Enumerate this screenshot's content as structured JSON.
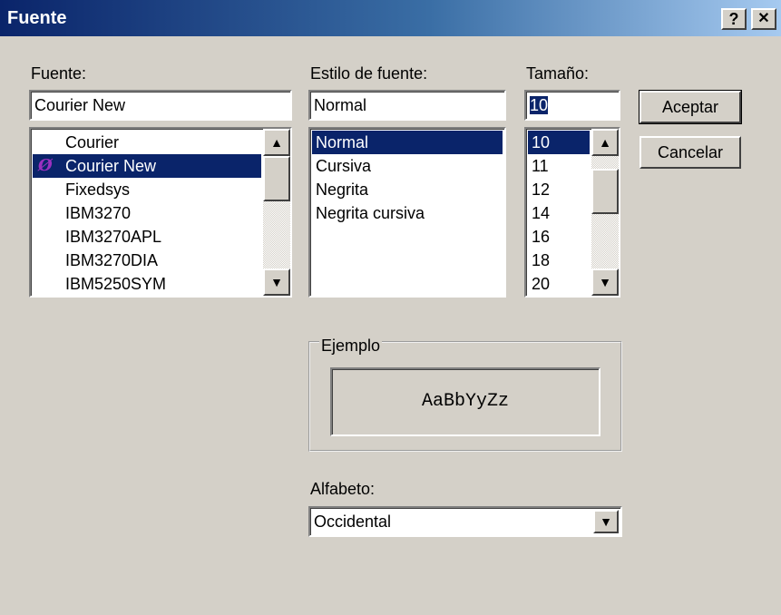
{
  "window": {
    "title": "Fuente",
    "help_label": "?",
    "close_label": "✕"
  },
  "font": {
    "label": "Fuente:",
    "value": "Courier New",
    "items": [
      {
        "label": "Courier",
        "truetype": false,
        "selected": false
      },
      {
        "label": "Courier New",
        "truetype": true,
        "selected": true
      },
      {
        "label": "Fixedsys",
        "truetype": false,
        "selected": false
      },
      {
        "label": "IBM3270",
        "truetype": false,
        "selected": false
      },
      {
        "label": "IBM3270APL",
        "truetype": false,
        "selected": false
      },
      {
        "label": "IBM3270DIA",
        "truetype": false,
        "selected": false
      },
      {
        "label": "IBM5250SYM",
        "truetype": false,
        "selected": false
      }
    ]
  },
  "style": {
    "label": "Estilo de fuente:",
    "value": "Normal",
    "items": [
      {
        "label": "Normal",
        "selected": true
      },
      {
        "label": "Cursiva",
        "selected": false
      },
      {
        "label": "Negrita",
        "selected": false
      },
      {
        "label": "Negrita cursiva",
        "selected": false
      }
    ]
  },
  "size": {
    "label": "Tamaño:",
    "value": "10",
    "items": [
      {
        "label": "10",
        "selected": true
      },
      {
        "label": "11",
        "selected": false
      },
      {
        "label": "12",
        "selected": false
      },
      {
        "label": "14",
        "selected": false
      },
      {
        "label": "16",
        "selected": false
      },
      {
        "label": "18",
        "selected": false
      },
      {
        "label": "20",
        "selected": false
      }
    ]
  },
  "buttons": {
    "ok_label": "Aceptar",
    "cancel_label": "Cancelar"
  },
  "sample": {
    "label": "Ejemplo",
    "text": "AaBbYyZz"
  },
  "script": {
    "label": "Alfabeto:",
    "value": "Occidental"
  },
  "icons": {
    "truetype": "truetype-icon",
    "scroll_up": "▲",
    "scroll_down": "▼",
    "dropdown": "▼"
  },
  "colors": {
    "selection": "#0a246a",
    "face": "#d4d0c8",
    "title_start": "#0a246a",
    "title_end": "#a6caf0"
  }
}
